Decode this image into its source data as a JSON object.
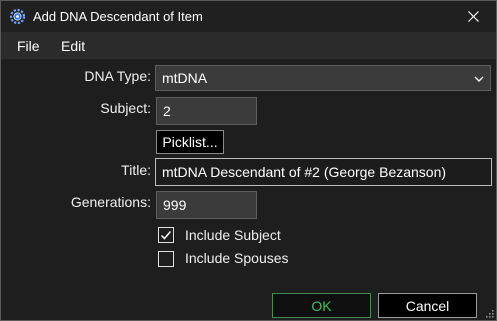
{
  "window": {
    "title": "Add DNA Descendant of Item",
    "icon": "gear-app-icon",
    "close_icon": "close-icon"
  },
  "menu": {
    "items": [
      {
        "label": "File"
      },
      {
        "label": "Edit"
      }
    ]
  },
  "form": {
    "dna_type_label": "DNA Type:",
    "dna_type_value": "mtDNA",
    "subject_label": "Subject:",
    "subject_value": "2",
    "picklist_label": "Picklist...",
    "title_label": "Title:",
    "title_value": "mtDNA Descendant of #2 (George Bezanson)",
    "generations_label": "Generations:",
    "generations_value": "999",
    "include_subject_label": "Include Subject",
    "include_subject_checked": true,
    "include_spouses_label": "Include Spouses",
    "include_spouses_checked": false
  },
  "buttons": {
    "ok_label": "OK",
    "cancel_label": "Cancel"
  },
  "colors": {
    "ok_text": "#3fbf5f",
    "background": "#1e1e1e",
    "menubar": "#2b2b2b"
  }
}
